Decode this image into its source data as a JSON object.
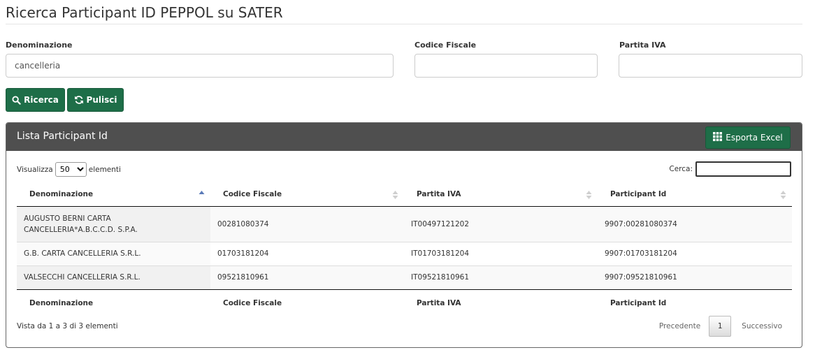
{
  "page": {
    "title": "Ricerca Participant ID PEPPOL su SATER"
  },
  "form": {
    "denominazione": {
      "label": "Denominazione",
      "value": "cancelleria"
    },
    "codice_fiscale": {
      "label": "Codice Fiscale",
      "value": ""
    },
    "partita_iva": {
      "label": "Partita IVA",
      "value": ""
    }
  },
  "buttons": {
    "search": "Ricerca",
    "clear": "Pulisci"
  },
  "panel": {
    "title": "Lista Participant Id",
    "export": "Esporta Excel",
    "length_prefix": "Visualizza",
    "length_value": "50",
    "length_suffix": "elementi",
    "search_label": "Cerca:"
  },
  "table": {
    "headers": [
      "Denominazione",
      "Codice Fiscale",
      "Partita IVA",
      "Participant Id"
    ],
    "rows": [
      [
        "AUGUSTO BERNI CARTA CANCELLERIA*A.B.C.C.D. S.P.A.",
        "00281080374",
        "IT00497121202",
        "9907:00281080374"
      ],
      [
        "G.B. CARTA CANCELLERIA S.R.L.",
        "01703181204",
        "IT01703181204",
        "9907:01703181204"
      ],
      [
        "VALSECCHI CANCELLERIA S.R.L.",
        "09521810961",
        "IT09521810961",
        "9907:09521810961"
      ]
    ],
    "info": "Vista da 1 a 3 di 3 elementi"
  },
  "pagination": {
    "prev": "Precedente",
    "page": "1",
    "next": "Successivo"
  },
  "colors": {
    "accent": "#1e6e48",
    "panel_header": "#4f4f4f"
  }
}
